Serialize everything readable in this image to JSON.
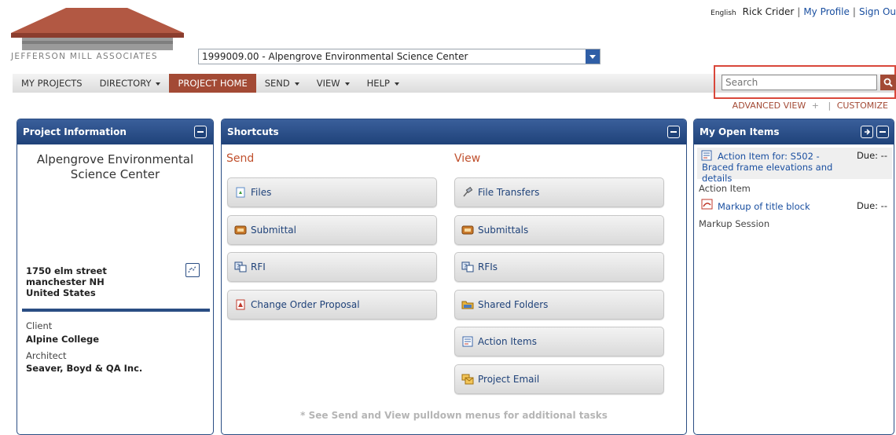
{
  "header": {
    "language": "English",
    "user_name": "Rick Crider",
    "separator": "|",
    "my_profile": "My Profile",
    "sign_out": "Sign Ou"
  },
  "logo": {
    "text": "JEFFERSON MILL ASSOCIATES"
  },
  "project_selector": {
    "value": "1999009.00 - Alpengrove Environmental Science Center"
  },
  "nav": {
    "items": [
      {
        "label": "MY PROJECTS",
        "has_caret": false
      },
      {
        "label": "DIRECTORY",
        "has_caret": true
      },
      {
        "label": "PROJECT HOME",
        "has_caret": false,
        "active": true
      },
      {
        "label": "SEND",
        "has_caret": true
      },
      {
        "label": "VIEW",
        "has_caret": true
      },
      {
        "label": "HELP",
        "has_caret": true
      }
    ]
  },
  "search": {
    "placeholder": "Search"
  },
  "links": {
    "advanced_view": "ADVANCED VIEW",
    "plus": "+",
    "divider": "|",
    "customize": "CUSTOMIZE"
  },
  "project_info": {
    "title": "Project Information",
    "project_name": "Alpengrove Environmental Science Center",
    "address_line1": "1750 elm street",
    "address_line2": "manchester NH",
    "address_line3": "United States",
    "client_label": "Client",
    "client_value": "Alpine College",
    "architect_label": "Architect",
    "architect_value": "Seaver, Boyd & QA Inc."
  },
  "shortcuts": {
    "title": "Shortcuts",
    "send_heading": "Send",
    "view_heading": "View",
    "send_items": [
      "Files",
      "Submittal",
      "RFI",
      "Change Order Proposal"
    ],
    "view_items": [
      "File Transfers",
      "Submittals",
      "RFIs",
      "Shared Folders",
      "Action Items",
      "Project Email"
    ],
    "note": "* See Send and View pulldown menus for additional tasks"
  },
  "open_items": {
    "title": "My Open Items",
    "items": [
      {
        "link": "Action Item for: S502 - Braced frame elevations and details",
        "due": "Due: --",
        "type": "Action Item"
      },
      {
        "link": "Markup of title block",
        "due": "Due: --",
        "type": "Markup Session"
      }
    ]
  },
  "colors": {
    "accent": "#a34a35",
    "panel_header": "#1f4279",
    "link": "#1a4fa0",
    "heading": "#c0502d"
  }
}
